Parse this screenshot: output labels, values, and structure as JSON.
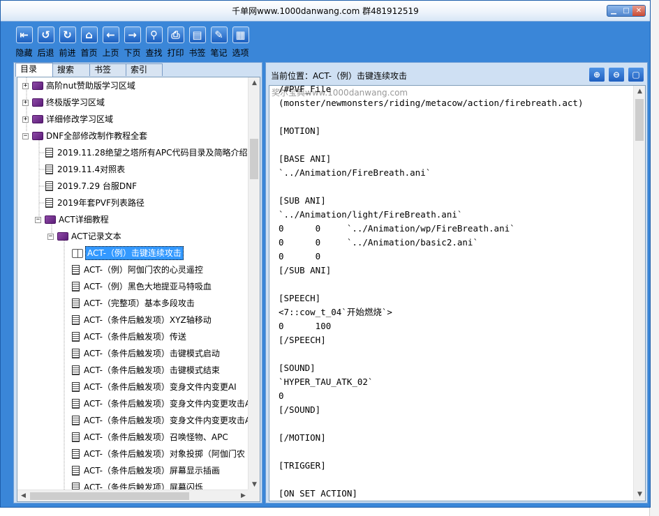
{
  "window": {
    "title": "千单网www.1000danwang.com 群481912519",
    "controls": [
      "▁",
      "□",
      "✕"
    ]
  },
  "toolbar": [
    {
      "label": "隐藏",
      "icon": "hide-icon",
      "glyph": "⇤"
    },
    {
      "label": "后退",
      "icon": "back-icon",
      "glyph": "↺"
    },
    {
      "label": "前进",
      "icon": "forward-icon",
      "glyph": "↻"
    },
    {
      "label": "首页",
      "icon": "home-icon",
      "glyph": "⌂"
    },
    {
      "label": "上页",
      "icon": "prev-page-icon",
      "glyph": "←"
    },
    {
      "label": "下页",
      "icon": "next-page-icon",
      "glyph": "→"
    },
    {
      "label": "查找",
      "icon": "search-icon",
      "glyph": "⚲"
    },
    {
      "label": "打印",
      "icon": "print-icon",
      "glyph": "⎙"
    },
    {
      "label": "书签",
      "icon": "bookmark-icon",
      "glyph": "▤"
    },
    {
      "label": "笔记",
      "icon": "note-icon",
      "glyph": "✎"
    },
    {
      "label": "选项",
      "icon": "options-icon",
      "glyph": "▦"
    }
  ],
  "tabs": [
    "目录",
    "搜索",
    "书签",
    "索引"
  ],
  "active_tab": "目录",
  "tree": [
    {
      "label": "高阶nut赞助版学习区域",
      "type": "book",
      "expander": "+"
    },
    {
      "label": "终极版学习区域",
      "type": "book",
      "expander": "+"
    },
    {
      "label": "详细修改学习区域",
      "type": "book",
      "expander": "+"
    },
    {
      "label": "DNF全部修改制作教程全套",
      "type": "book",
      "expander": "−"
    },
    {
      "label": "2019.11.28绝望之塔所有APC代码目录及简略介绍",
      "type": "doc"
    },
    {
      "label": "2019.11.4对照表",
      "type": "doc"
    },
    {
      "label": "2019.7.29  台服DNF",
      "type": "doc"
    },
    {
      "label": "2019年套PVF列表路径",
      "type": "doc"
    },
    {
      "label": "ACT详细教程",
      "type": "book",
      "expander": "−"
    },
    {
      "label": "ACT记录文本",
      "type": "book",
      "expander": "−"
    },
    {
      "label": "ACT-（例）击键连续攻击",
      "type": "open",
      "selected": true
    },
    {
      "label": "ACT-（例）阿伽门农的心灵遥控",
      "type": "doc"
    },
    {
      "label": "ACT-（例）黑色大地提亚马特吸血",
      "type": "doc"
    },
    {
      "label": "ACT-（完整项）基本多段攻击",
      "type": "doc"
    },
    {
      "label": "ACT-（条件后触发项）XYZ轴移动",
      "type": "doc"
    },
    {
      "label": "ACT-（条件后触发项）传送",
      "type": "doc"
    },
    {
      "label": "ACT-（条件后触发项）击键模式启动",
      "type": "doc"
    },
    {
      "label": "ACT-（条件后触发项）击键模式结束",
      "type": "doc"
    },
    {
      "label": "ACT-（条件后触发项）变身文件内变更AI",
      "type": "doc"
    },
    {
      "label": "ACT-（条件后触发项）变身文件内变更攻击A",
      "type": "doc"
    },
    {
      "label": "ACT-（条件后触发项）变身文件内变更攻击A",
      "type": "doc"
    },
    {
      "label": "ACT-（条件后触发项）召唤怪物、APC",
      "type": "doc"
    },
    {
      "label": "ACT-（条件后触发项）对象投掷（阿伽门农",
      "type": "doc"
    },
    {
      "label": "ACT-（条件后触发项）屏幕显示插画",
      "type": "doc"
    },
    {
      "label": "ACT-（条件后触发项）屏幕闪烁",
      "type": "doc"
    }
  ],
  "location": {
    "prefix": "当前位置：",
    "value": "ACT-（例）击键连续攻击"
  },
  "right_buttons": [
    {
      "icon": "zoom-in-icon",
      "glyph": "⊕"
    },
    {
      "icon": "zoom-out-icon",
      "glyph": "⊖"
    },
    {
      "icon": "fullscreen-icon",
      "glyph": "▢"
    }
  ],
  "watermark": "奖尔宝典www.1000danwang.com",
  "content_lines": [
    "/#PVF_File",
    "(monster/newmonsters/riding/metacow/action/firebreath.act)",
    "",
    "[MOTION]",
    "",
    "[BASE ANI]",
    "`../Animation/FireBreath.ani`",
    "",
    "[SUB ANI]",
    "`../Animation/light/FireBreath.ani`",
    "0      0     `../Animation/wp/FireBreath.ani`",
    "0      0     `../Animation/basic2.ani`",
    "0      0",
    "[/SUB ANI]",
    "",
    "[SPEECH]",
    "<7::cow_t_04`开始燃烧`>",
    "0      100",
    "[/SPEECH]",
    "",
    "[SOUND]",
    "`HYPER_TAU_ATK_02`",
    "0",
    "[/SOUND]",
    "",
    "[/MOTION]",
    "",
    "[TRIGGER]",
    "",
    "[ON SET ACTION]"
  ]
}
